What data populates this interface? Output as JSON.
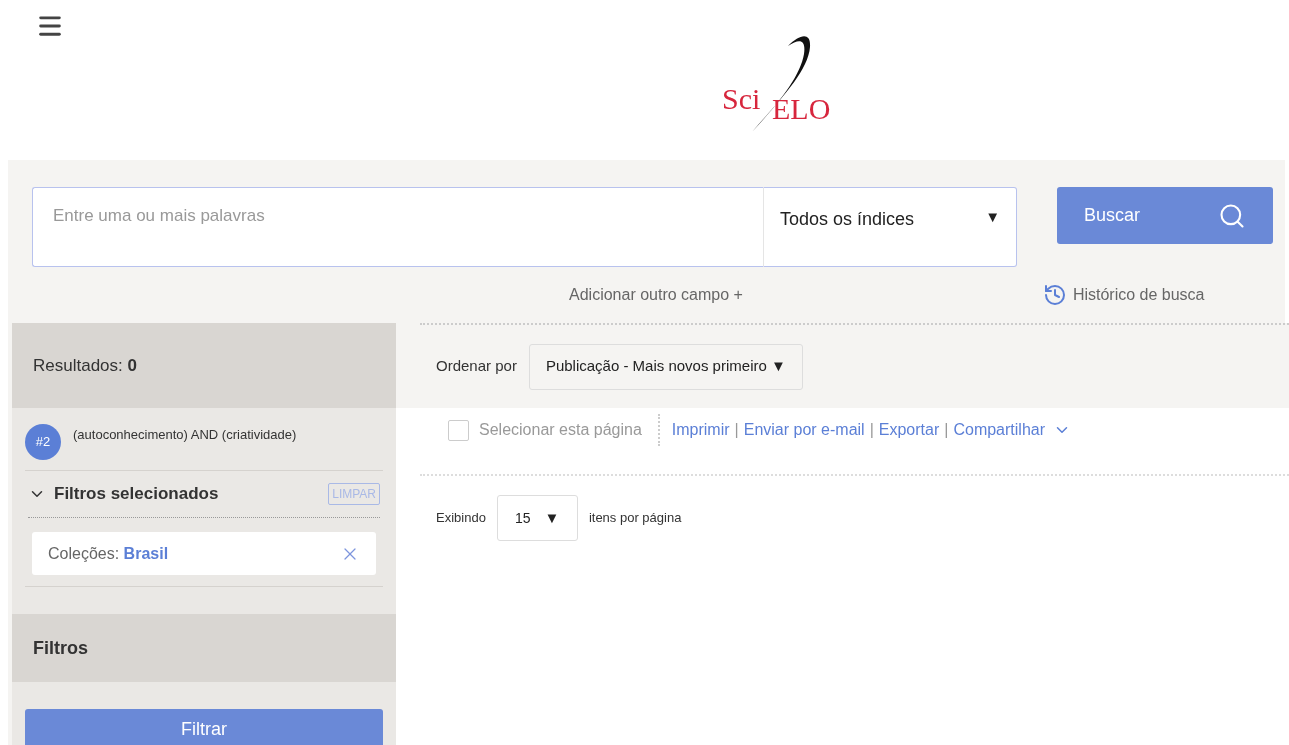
{
  "logo": {
    "left": "Sci",
    "right": "ELO"
  },
  "search": {
    "placeholder": "Entre uma ou mais palavras",
    "index_select": "Todos os índices",
    "index_caret": "▼",
    "button": "Buscar"
  },
  "add_field": "Adicionar outro campo +",
  "history": "Histórico de busca",
  "sidebar": {
    "results_label": "Resultados:",
    "results_count": "0",
    "query": {
      "badge": "#2",
      "text": "(autoconhecimento) AND (criatividade)"
    },
    "selected_filters": {
      "title": "Filtros selecionados",
      "expanded": true,
      "clear": "LIMPAR",
      "items": [
        {
          "label": "Coleções:",
          "value": "Brasil"
        }
      ]
    },
    "filters_title": "Filtros",
    "filter_button": "Filtrar"
  },
  "sort": {
    "label": "Ordenar por",
    "value": "Publicação - Mais novos primeiro",
    "caret": "▼"
  },
  "select_page": {
    "label": "Selecionar esta página",
    "checked": false
  },
  "actions": [
    {
      "label": "Imprimir"
    },
    {
      "label": "Enviar por e-mail"
    },
    {
      "label": "Exportar"
    },
    {
      "label": "Compartilhar"
    }
  ],
  "separators": [
    "|",
    "|",
    "|"
  ],
  "per_page": {
    "label": "Exibindo",
    "value": "15",
    "caret": "▼",
    "suffix": "itens por página"
  }
}
